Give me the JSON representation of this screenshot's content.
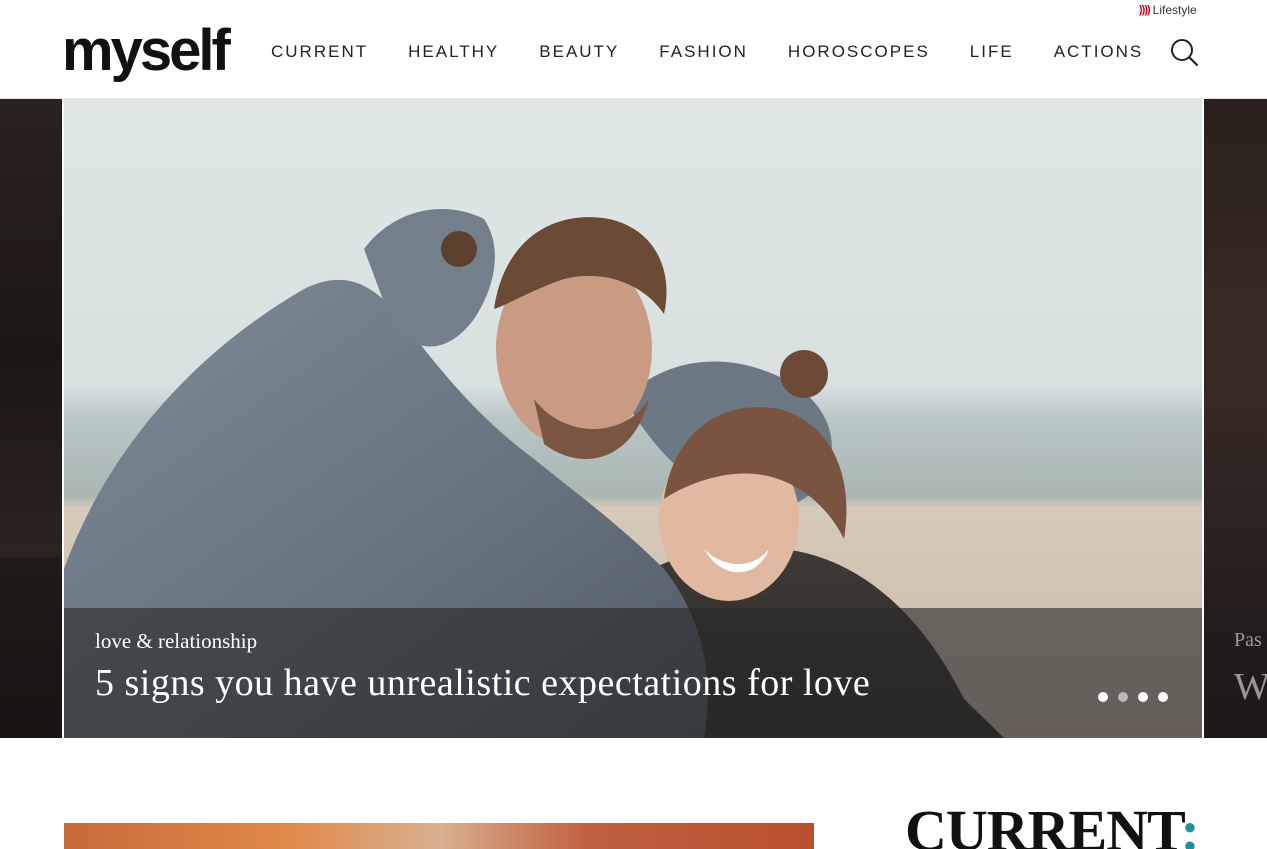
{
  "header": {
    "logo": "myself",
    "network_label": "Lifestyle",
    "nav": [
      {
        "label": "CURRENT"
      },
      {
        "label": "HEALTHY"
      },
      {
        "label": "BEAUTY"
      },
      {
        "label": "FASHION"
      },
      {
        "label": "HOROSCOPES"
      },
      {
        "label": "LIFE"
      },
      {
        "label": "ACTIONS"
      }
    ],
    "search_icon": "search-icon"
  },
  "hero": {
    "active_slide": {
      "category": "love & relationship",
      "title": "5 signs you have unrealistic expectations for love"
    },
    "next_slide": {
      "category_fragment": "Pas",
      "title_fragment": "W"
    },
    "dots": {
      "count": 4,
      "active_index": 0
    },
    "colors": {
      "caption_overlay": "#282828",
      "dot_active": "#ffffff",
      "dot_inactive": "#b9b9b9"
    }
  },
  "section": {
    "title": "CURRENT",
    "colon": ":",
    "colon_color": "#1d8fa0"
  }
}
